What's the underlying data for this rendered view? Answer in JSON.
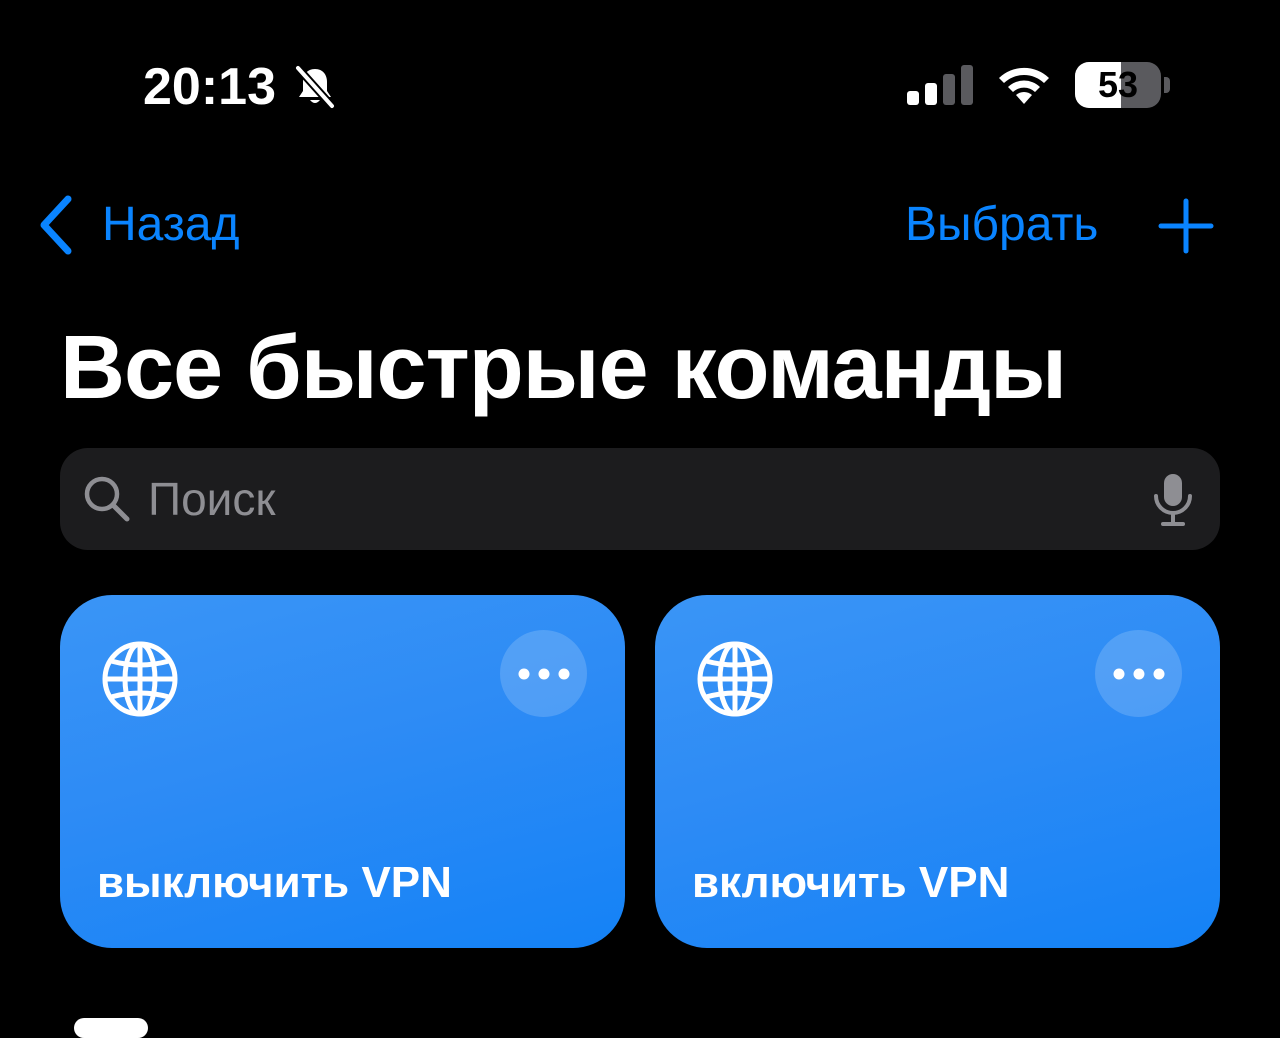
{
  "status_bar": {
    "time": "20:13",
    "silent_icon": "bell-slash-icon",
    "signal_icon": "cellular-signal-icon",
    "signal_bars_active": 2,
    "signal_bars_total": 4,
    "wifi_icon": "wifi-icon",
    "battery_percent": "53",
    "battery_level": 0.53
  },
  "nav": {
    "back_label": "Назад",
    "back_icon": "chevron-left-icon",
    "select_label": "Выбрать",
    "add_icon": "plus-icon"
  },
  "page": {
    "title": "Все быстрые команды"
  },
  "search": {
    "placeholder": "Поиск",
    "value": "",
    "icon": "search-icon",
    "mic_icon": "microphone-icon"
  },
  "shortcuts": [
    {
      "title": "выключить VPN",
      "icon": "globe-icon",
      "menu_icon": "ellipsis-icon"
    },
    {
      "title": "включить VPN",
      "icon": "globe-icon",
      "menu_icon": "ellipsis-icon"
    }
  ],
  "colors": {
    "background": "#000000",
    "accent": "#0a84ff",
    "card": "#2d8bf5",
    "search_field": "#1c1c1e",
    "placeholder": "#8e8e93"
  }
}
